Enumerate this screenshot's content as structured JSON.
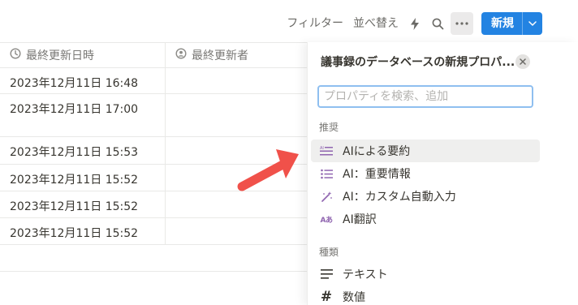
{
  "toolbar": {
    "filter_label": "フィルター",
    "sort_label": "並べ替え",
    "automation_icon": "lightning-icon",
    "search_icon": "search-icon",
    "more_icon": "more-icon",
    "new_label": "新規",
    "accent_color": "#2383e2"
  },
  "table": {
    "columns": [
      {
        "label": "最終更新日時",
        "icon": "clock-icon"
      },
      {
        "label": "最終更新者",
        "icon": "person-icon"
      }
    ],
    "rows": [
      {
        "updated_at": "2023年12月11日 16:48"
      },
      {
        "updated_at": "2023年12月11日 17:00"
      },
      {
        "updated_at": "2023年12月11日 15:53"
      },
      {
        "updated_at": "2023年12月11日 15:52"
      },
      {
        "updated_at": "2023年12月11日 15:52"
      },
      {
        "updated_at": "2023年12月11日 15:52"
      }
    ]
  },
  "panel": {
    "title": "議事録のデータベースの新規プロパ...",
    "search_placeholder": "プロパティを検索、追加",
    "section_recommended": "推奨",
    "recommended": [
      {
        "label": "AIによる要約",
        "icon": "ai-summary-icon"
      },
      {
        "label": "AI：重要情報",
        "icon": "list-icon"
      },
      {
        "label": "AI：カスタム自動入力",
        "icon": "magic-wand-icon"
      },
      {
        "label": "AI翻訳",
        "icon": "ai-translate-icon"
      }
    ],
    "section_types": "種類",
    "types": [
      {
        "label": "テキスト",
        "icon": "text-lines-icon"
      },
      {
        "label": "数値",
        "icon": "hash-icon"
      }
    ],
    "ai_color": "#9065b0"
  },
  "annotation": {
    "arrow_color": "#f0514a"
  }
}
